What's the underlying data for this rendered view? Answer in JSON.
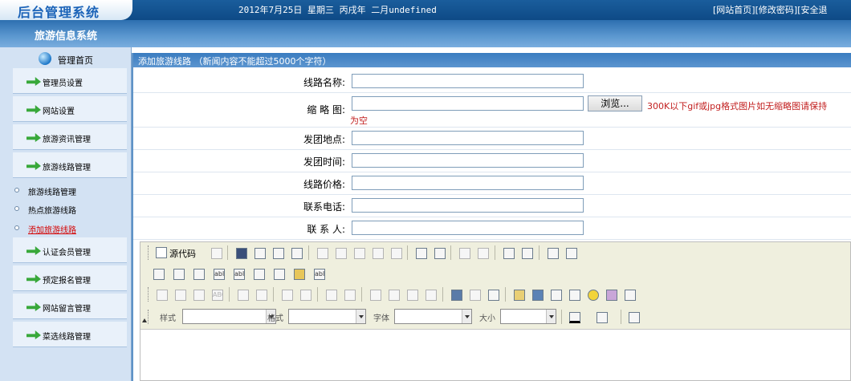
{
  "header": {
    "logo": "后台管理系统",
    "date": "2012年7月25日 星期三 丙戌年 二月undefined",
    "links": [
      "[网站首页]",
      "[修改密码]",
      "[安全退"
    ]
  },
  "subheader": {
    "system_name": "旅游信息系统"
  },
  "sidebar": {
    "home_label": "管理首页",
    "items": [
      {
        "label": "管理员设置"
      },
      {
        "label": "网站设置"
      },
      {
        "label": "旅游资讯管理"
      },
      {
        "label": "旅游线路管理"
      }
    ],
    "sub_items": [
      {
        "label": "旅游线路管理",
        "active": false
      },
      {
        "label": "热点旅游线路",
        "active": false
      },
      {
        "label": "添加旅游线路",
        "active": true
      }
    ],
    "items_after": [
      {
        "label": "认证会员管理"
      },
      {
        "label": "预定报名管理"
      },
      {
        "label": "网站留言管理"
      },
      {
        "label": "菜选线路管理"
      }
    ]
  },
  "form": {
    "title": "添加旅游线路 （新闻内容不能超过5000个字符）",
    "fields": {
      "name": {
        "label": "线路名称:",
        "value": ""
      },
      "thumb": {
        "label": "缩 略 图:",
        "value": "",
        "browse": "浏览...",
        "hint": "300K以下gif或jpg格式图片如无缩略图请保持",
        "hint2": "为空"
      },
      "origin": {
        "label": "发团地点:",
        "value": ""
      },
      "time": {
        "label": "发团时间:",
        "value": ""
      },
      "price": {
        "label": "线路价格:",
        "value": ""
      },
      "phone": {
        "label": "联系电话:",
        "value": ""
      },
      "contact": {
        "label": "联 系 人:",
        "value": ""
      }
    }
  },
  "editor": {
    "source_label": "源代码",
    "combo_labels": {
      "style": "样式",
      "format": "格式",
      "font": "字体",
      "size": "大小"
    },
    "glyphs": {
      "input_text": "abl",
      "textarea": "abl",
      "hidden": "abl",
      "strike": "ABC"
    }
  },
  "colors": {
    "header_blue": "#0e4a86",
    "sidebar_bg": "#d3e2f3",
    "hint_red": "#c21f1f",
    "toolbar_bg": "#efefde"
  }
}
